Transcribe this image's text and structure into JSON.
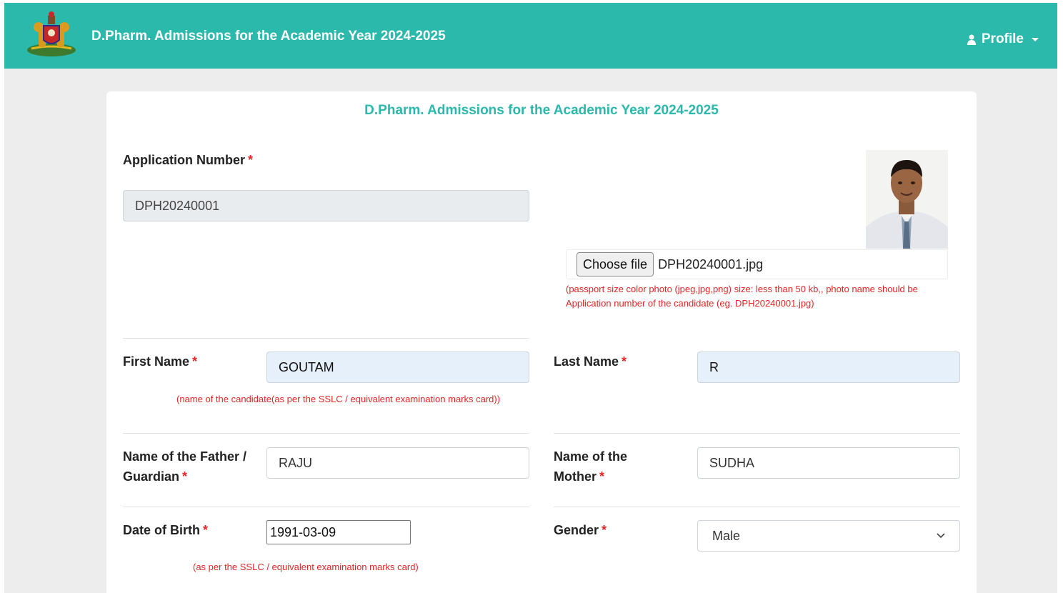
{
  "navbar": {
    "title": "D.Pharm. Admissions for the Academic Year 2024-2025",
    "profile_label": "Profile"
  },
  "form": {
    "heading": "D.Pharm. Admissions for the Academic Year 2024-2025",
    "application_number": {
      "label": "Application Number",
      "value": "DPH20240001"
    },
    "photo": {
      "button_label": "Choose file",
      "file_name": "DPH20240001.jpg",
      "hint": "(passport size color photo (jpeg,jpg,png) size: less than 50 kb,, photo name should be Application number of the candidate (eg. DPH20240001.jpg)"
    },
    "first_name": {
      "label": "First Name",
      "value": "GOUTAM",
      "hint": "(name of the candidate(as per the SSLC / equivalent examination marks card))"
    },
    "last_name": {
      "label": "Last Name",
      "value": "R"
    },
    "father_name": {
      "label": "Name of the Father / Guardian",
      "value": "RAJU"
    },
    "mother_name": {
      "label": "Name of the Mother",
      "value": "SUDHA"
    },
    "dob": {
      "label": "Date of Birth",
      "value": "1991-03-09",
      "hint": "(as per the SSLC / equivalent examination marks card)"
    },
    "gender": {
      "label": "Gender",
      "value": "Male"
    },
    "required_mark": "*"
  },
  "colors": {
    "brand": "#2ab9ab",
    "required": "#e52525"
  }
}
